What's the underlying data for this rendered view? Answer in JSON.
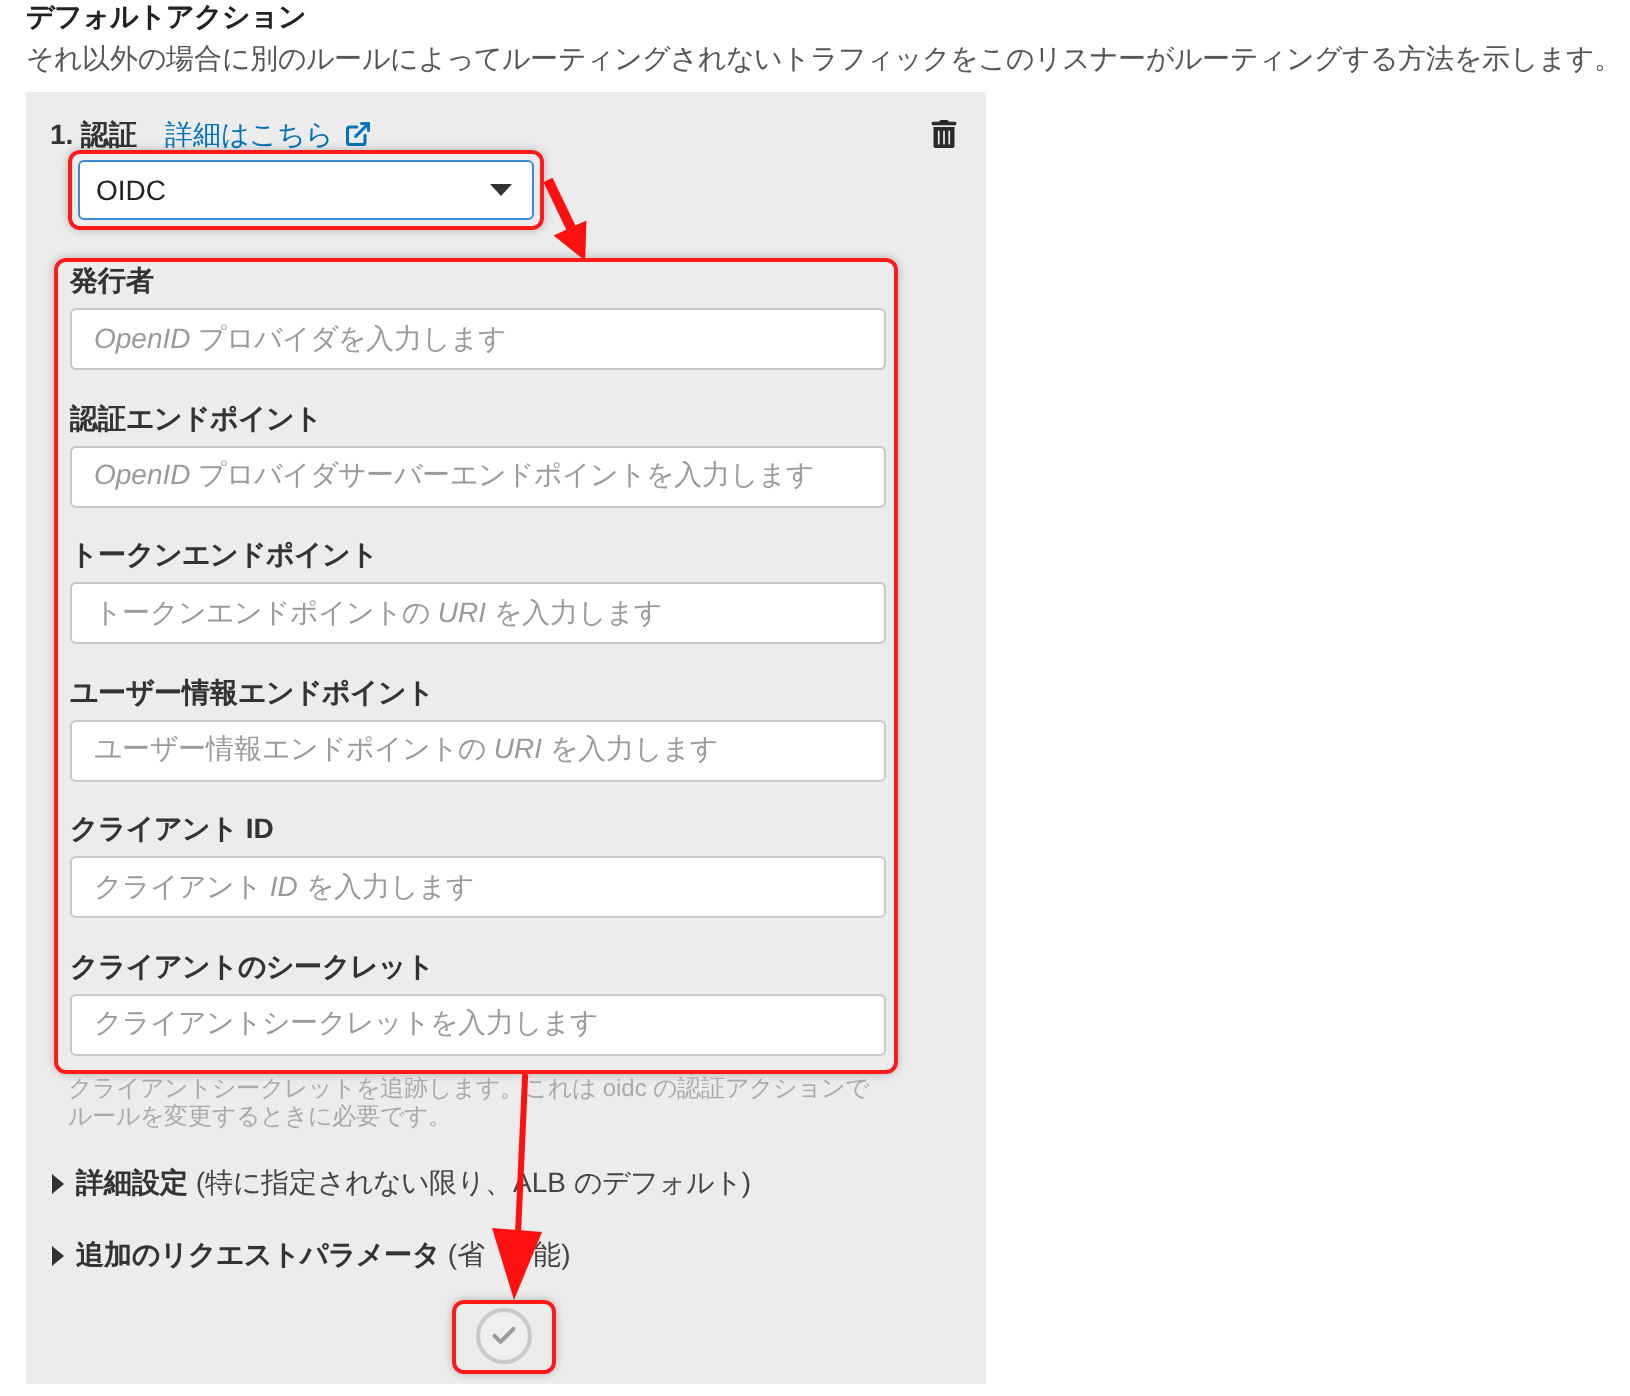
{
  "section": {
    "title": "デフォルトアクション",
    "description": "それ以外の場合に別のルールによってルーティングされないトラフィックをこのリスナーがルーティングする方法を示します。"
  },
  "action": {
    "heading": "1. 認証",
    "link": "詳細はこちら",
    "select": {
      "value": "OIDC"
    },
    "fields": [
      {
        "label": "発行者",
        "placeholder": "*OpenID* プロバイダを入力します"
      },
      {
        "label": "認証エンドポイント",
        "placeholder": "*OpenID* プロバイダサーバーエンドポイントを入力します"
      },
      {
        "label": "トークンエンドポイント",
        "placeholder": "トークンエンドポイントの *URI* を入力します"
      },
      {
        "label": "ユーザー情報エンドポイント",
        "placeholder": "ユーザー情報エンドポイントの *URI* を入力します"
      },
      {
        "label": "クライアント ID",
        "placeholder": "クライアント *ID* を入力します"
      },
      {
        "label": "クライアントのシークレット",
        "placeholder": "クライアントシークレットを入力します"
      }
    ],
    "hint": "クライアントシークレットを追跡します。これは oidc の認証アクションでルールを変更するときに必要です。",
    "expanders": [
      {
        "label": "**詳細設定** (特に指定されない限り、ALB のデフォルト)",
        "expanded": false
      },
      {
        "label": "**追加のリクエストパラメータ** (省",
        "label_tail": "能)",
        "expanded": false
      }
    ]
  }
}
